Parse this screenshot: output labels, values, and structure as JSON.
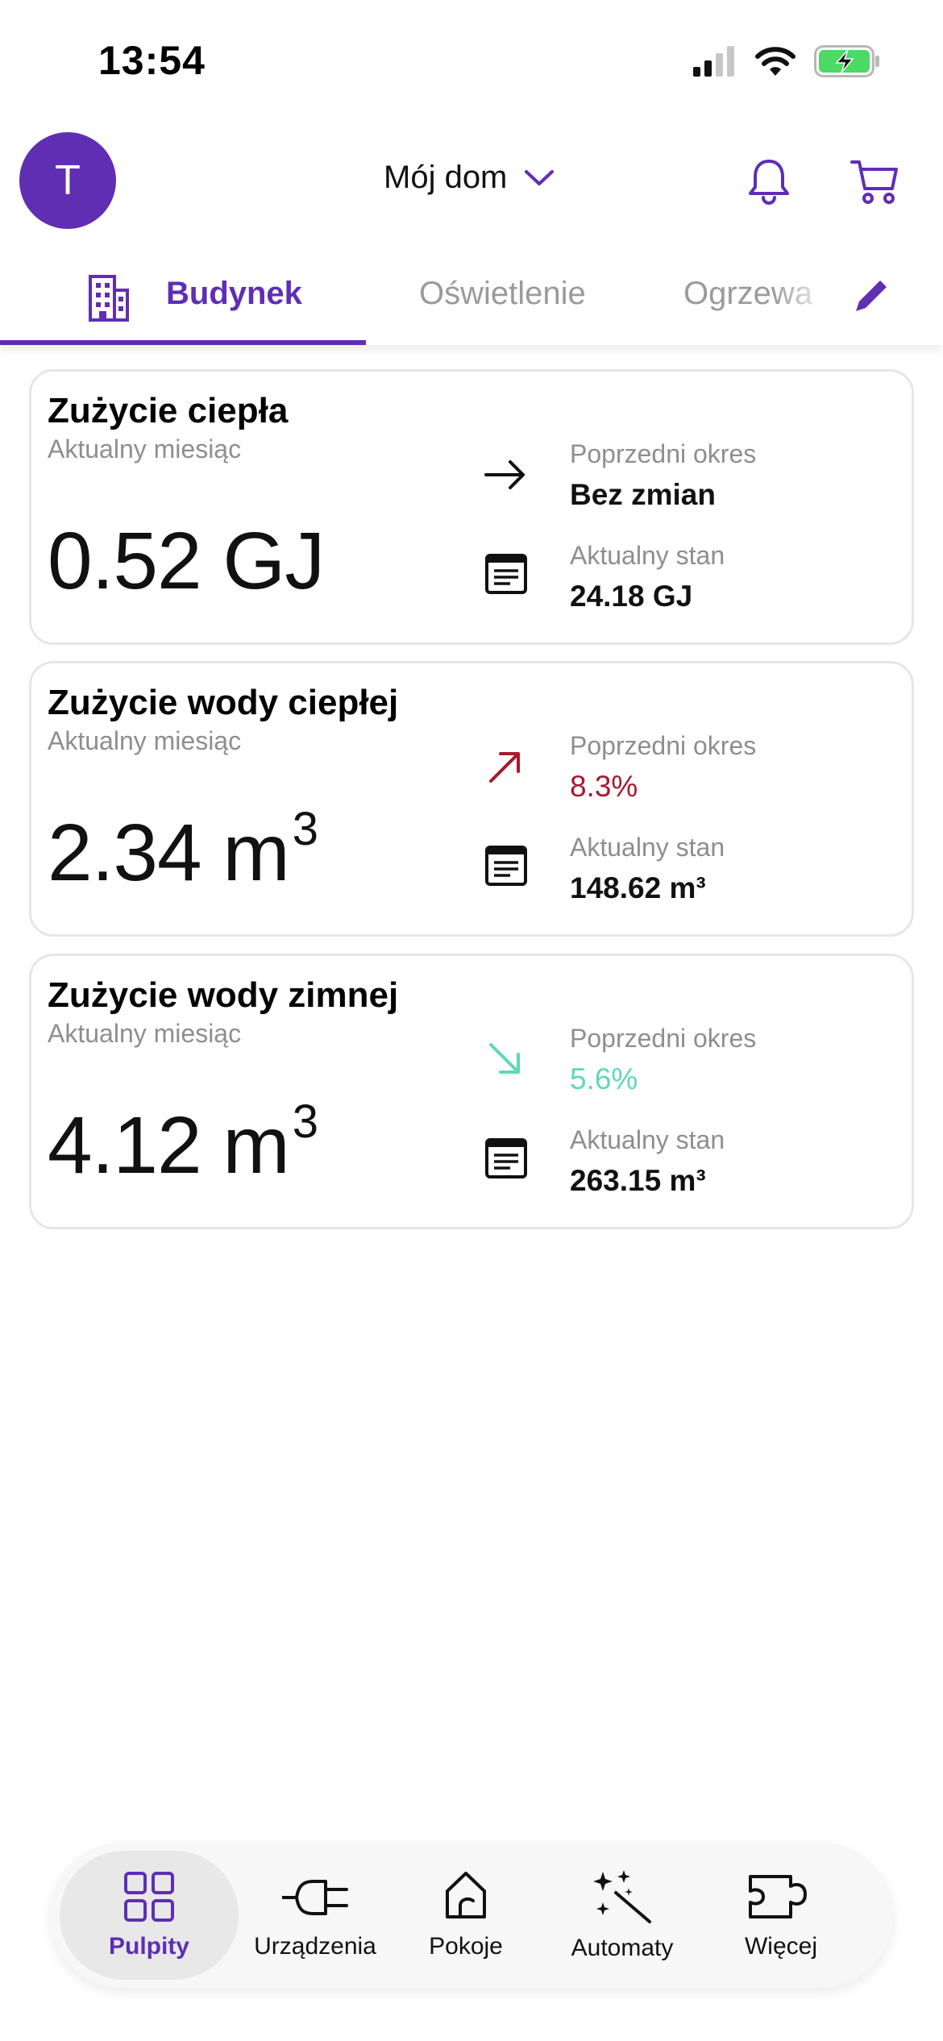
{
  "status_bar": {
    "time": "13:54"
  },
  "header": {
    "avatar_initial": "T",
    "home_name": "Mój dom"
  },
  "tabs": [
    {
      "label": "Budynek",
      "active": true
    },
    {
      "label": "Oświetlenie",
      "active": false
    },
    {
      "label": "Ogrzewa",
      "active": false
    }
  ],
  "cards": [
    {
      "title": "Zużycie ciepła",
      "subtitle": "Aktualny miesiąc",
      "value": "0.52 GJ",
      "value_sup": "",
      "trend": "flat",
      "prev_label": "Poprzedni okres",
      "prev_value": "Bez zmian",
      "state_label": "Aktualny stan",
      "state_value": "24.18 GJ"
    },
    {
      "title": "Zużycie wody ciepłej",
      "subtitle": "Aktualny miesiąc",
      "value": "2.34 m",
      "value_sup": "3",
      "trend": "up",
      "prev_label": "Poprzedni okres",
      "prev_value": "8.3%",
      "state_label": "Aktualny stan",
      "state_value": "148.62 m³"
    },
    {
      "title": "Zużycie wody zimnej",
      "subtitle": "Aktualny miesiąc",
      "value": "4.12 m",
      "value_sup": "3",
      "trend": "down",
      "prev_label": "Poprzedni okres",
      "prev_value": "5.6%",
      "state_label": "Aktualny stan",
      "state_value": "263.15 m³"
    }
  ],
  "bottom_nav": [
    {
      "label": "Pulpity",
      "icon": "dashboard-icon",
      "active": true
    },
    {
      "label": "Urządzenia",
      "icon": "plug-icon",
      "active": false
    },
    {
      "label": "Pokoje",
      "icon": "room-icon",
      "active": false
    },
    {
      "label": "Automaty",
      "icon": "magic-wand-icon",
      "active": false
    },
    {
      "label": "Więcej",
      "icon": "puzzle-icon",
      "active": false
    }
  ],
  "colors": {
    "accent": "#5f2eb3",
    "trend_up": "#a8192e",
    "trend_down": "#5ed8b6",
    "battery": "#4cd964"
  }
}
